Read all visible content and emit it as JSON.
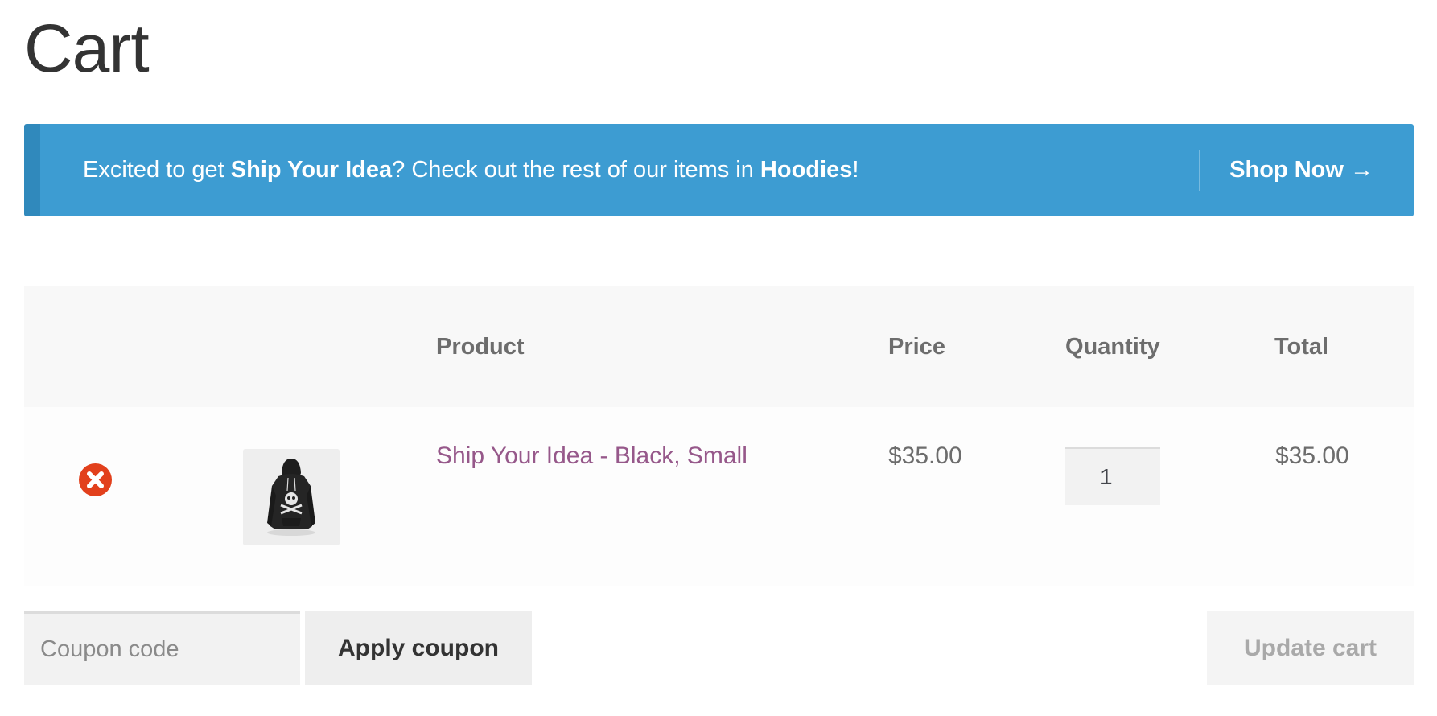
{
  "page": {
    "title": "Cart"
  },
  "notice": {
    "prefix": "Excited to get ",
    "product": "Ship Your Idea",
    "middle": "? Check out the rest of our items in ",
    "category": "Hoodies",
    "suffix": "!",
    "link_label": "Shop Now →",
    "bg_color": "#3d9cd2",
    "accent_color": "#3089bc"
  },
  "table": {
    "headers": {
      "product": "Product",
      "price": "Price",
      "quantity": "Quantity",
      "total": "Total"
    },
    "items": [
      {
        "remove_icon": "remove-circle-x-icon",
        "thumbnail": "black-hoodie-image",
        "name": "Ship Your Idea - Black, Small",
        "price": "$35.00",
        "quantity": "1",
        "total": "$35.00"
      }
    ]
  },
  "actions": {
    "coupon_placeholder": "Coupon code",
    "apply_label": "Apply coupon",
    "update_label": "Update cart"
  },
  "colors": {
    "link": "#96588a",
    "remove": "#e2401c"
  }
}
